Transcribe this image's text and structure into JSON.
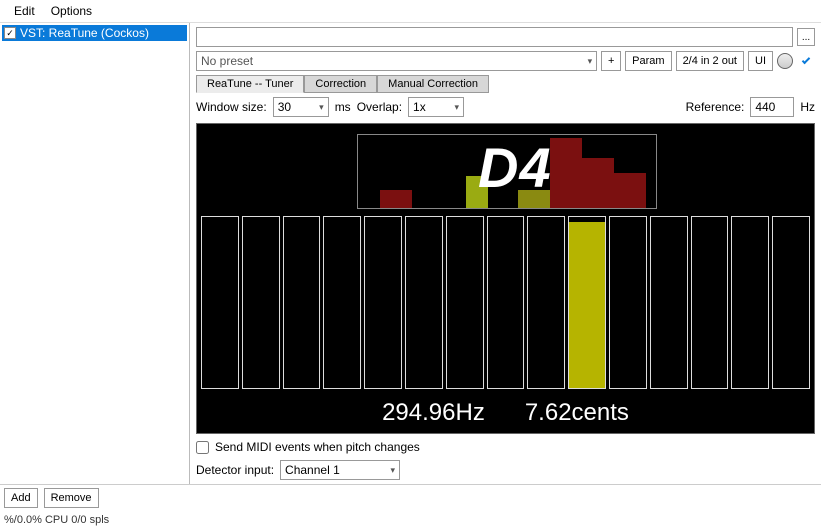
{
  "menu": {
    "edit": "Edit",
    "options": "Options"
  },
  "fx": {
    "selected": "VST: ReaTune (Cockos)"
  },
  "toolbar": {
    "more": "...",
    "preset": "No preset",
    "plus": "+",
    "param": "Param",
    "routing": "2/4 in 2 out",
    "ui": "UI"
  },
  "tabs": {
    "tuner": "ReaTune -- Tuner",
    "correction": "Correction",
    "manual": "Manual Correction"
  },
  "controls": {
    "window_label": "Window size:",
    "window_value": "30",
    "window_unit": "ms",
    "overlap_label": "Overlap:",
    "overlap_value": "1x",
    "reference_label": "Reference:",
    "reference_value": "440",
    "reference_unit": "Hz"
  },
  "tuner": {
    "note": "D4",
    "freq": "294.96Hz",
    "cents": "7.62cents",
    "bars": [
      0,
      0,
      0,
      0,
      0,
      0,
      0,
      0,
      0,
      97,
      0,
      0,
      0,
      0,
      0
    ],
    "bar_color": "#b6b400"
  },
  "below": {
    "midi_checkbox": "Send MIDI events when pitch changes",
    "detector_label": "Detector input:",
    "detector_value": "Channel 1"
  },
  "footer": {
    "add": "Add",
    "remove": "Remove",
    "status": "%/0.0% CPU 0/0 spls"
  }
}
